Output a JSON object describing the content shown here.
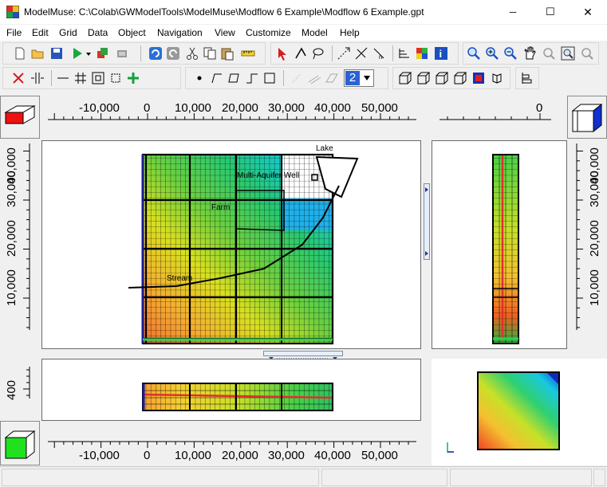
{
  "window": {
    "title": "ModelMuse: C:\\Colab\\GWModelTools\\ModelMuse\\Modflow 6 Example\\Modflow 6 Example.gpt",
    "minimize_glyph": "─",
    "maximize_glyph": "☐",
    "close_glyph": "✕"
  },
  "menu": {
    "items": [
      "File",
      "Edit",
      "Grid",
      "Data",
      "Object",
      "Navigation",
      "View",
      "Customize",
      "Model",
      "Help"
    ]
  },
  "toolbar": {
    "layer_selector_value": "2",
    "icons_row1": [
      "new-file-icon",
      "open-folder-icon",
      "save-icon",
      "run-model-icon",
      "dropdown-icon",
      "export-icon",
      "import-icon",
      "undo-icon",
      "redo-icon",
      "cut-icon",
      "copy-icon",
      "paste-icon",
      "measure-icon",
      "select-arrow-icon",
      "select-vertex-icon",
      "lasso-icon",
      "add-vertex-icon",
      "delete-vertex-icon",
      "subdivide-icon",
      "grid-spacing-icon",
      "color-grid-icon",
      "info-icon",
      "zoom-icon",
      "zoom-in-icon",
      "zoom-out-icon",
      "pan-icon",
      "zoom-extents-icon",
      "zoom-previous-icon",
      "zoom-next-icon"
    ],
    "icons_row2": [
      "delete-column-icon",
      "move-column-icon",
      "horizontal-line-icon",
      "grid-icon",
      "fit-grid-icon",
      "smooth-grid-icon",
      "add-point-icon",
      "point-object-icon",
      "line-object-icon",
      "polygon-object-icon",
      "straight-line-icon",
      "rectangle-icon",
      "dots-icon",
      "stripe-icon",
      "block-icon",
      "layer-selector",
      "cube-top-icon",
      "cube-front-icon",
      "cube-side-icon",
      "cube-3d-icon",
      "colored-cube-icon",
      "rotate-icon",
      "restore-icon"
    ]
  },
  "views": {
    "top": {
      "labels": {
        "lake": "Lake",
        "well": "Multi-Aquifer Well",
        "farm": "Farm",
        "stream": "Stream"
      }
    }
  },
  "rulers": {
    "top_x_ticks": [
      "-10,000",
      "0",
      "10,000",
      "20,000",
      "30,000",
      "40,000",
      "50,000"
    ],
    "top_right_tick": "0",
    "left_y_ticks": [
      "10,000",
      "20,000",
      "30,000",
      "40,000"
    ],
    "right_y_ticks": [
      "10,000",
      "20,000",
      "30,000",
      "40,000"
    ],
    "front_z_tick": "400",
    "bottom_x_ticks": [
      "-10,000",
      "0",
      "10,000",
      "20,000",
      "30,000",
      "40,000",
      "50,000"
    ]
  },
  "statusbar": {
    "cells": [
      "",
      "",
      "",
      ""
    ]
  }
}
